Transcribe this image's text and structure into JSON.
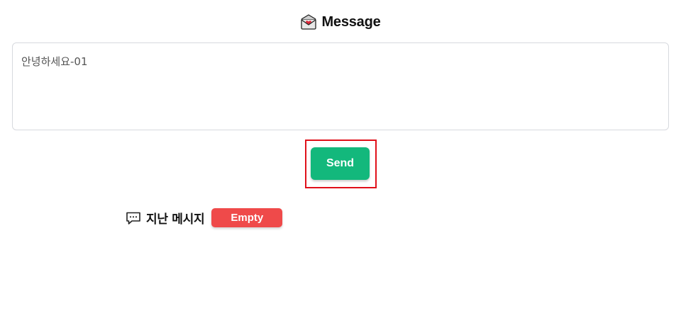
{
  "header": {
    "icon": "envelope-with-heart-icon",
    "title": "Message"
  },
  "message_input": {
    "value": "안녕하세요-01",
    "placeholder": ""
  },
  "send_button": {
    "label": "Send",
    "color": "#13b87c",
    "highlighted": true,
    "highlight_color": "#e0101a"
  },
  "history": {
    "icon": "speech-bubble-icon",
    "label": "지난 메시지",
    "badge": "Empty",
    "badge_color": "#ef4a4a"
  }
}
